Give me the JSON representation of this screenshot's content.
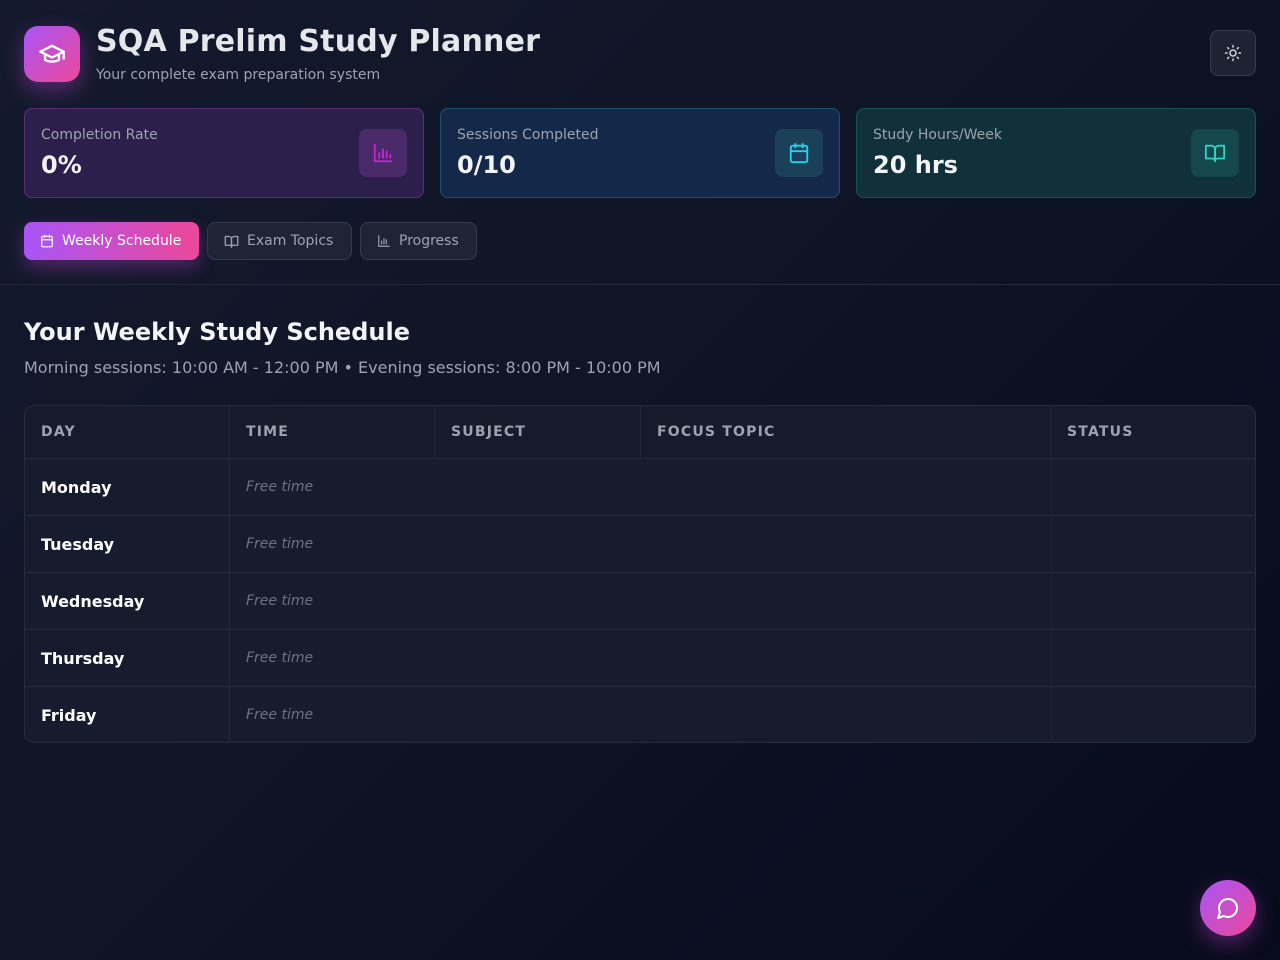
{
  "header": {
    "title": "SQA Prelim Study Planner",
    "subtitle": "Your complete exam preparation system",
    "logo_icon": "graduation-cap-icon",
    "theme_icon": "sun-icon"
  },
  "stats": [
    {
      "label": "Completion Rate",
      "value": "0%",
      "icon": "bar-chart-icon",
      "accent": "#a855f7"
    },
    {
      "label": "Sessions Completed",
      "value": "0/10",
      "icon": "calendar-icon",
      "accent": "#22d3ee"
    },
    {
      "label": "Study Hours/Week",
      "value": "20 hrs",
      "icon": "book-open-icon",
      "accent": "#2dd4bf"
    }
  ],
  "tabs": [
    {
      "label": "Weekly Schedule",
      "icon": "calendar-icon",
      "active": true
    },
    {
      "label": "Exam Topics",
      "icon": "book-open-icon",
      "active": false
    },
    {
      "label": "Progress",
      "icon": "bar-chart-icon",
      "active": false
    }
  ],
  "schedule": {
    "title": "Your Weekly Study Schedule",
    "subtitle": "Morning sessions: 10:00 AM - 12:00 PM • Evening sessions: 8:00 PM - 10:00 PM",
    "columns": [
      "DAY",
      "TIME",
      "SUBJECT",
      "FOCUS TOPIC",
      "STATUS"
    ],
    "rows": [
      {
        "day": "Monday",
        "time": "Free time"
      },
      {
        "day": "Tuesday",
        "time": "Free time"
      },
      {
        "day": "Wednesday",
        "time": "Free time"
      },
      {
        "day": "Thursday",
        "time": "Free time"
      },
      {
        "day": "Friday",
        "time": "Free time"
      }
    ]
  },
  "chat": {
    "icon": "chat-bubble-icon"
  },
  "colors": {
    "brand_gradient_start": "#a855f7",
    "brand_gradient_end": "#ec4899",
    "background": "#0f1426"
  }
}
